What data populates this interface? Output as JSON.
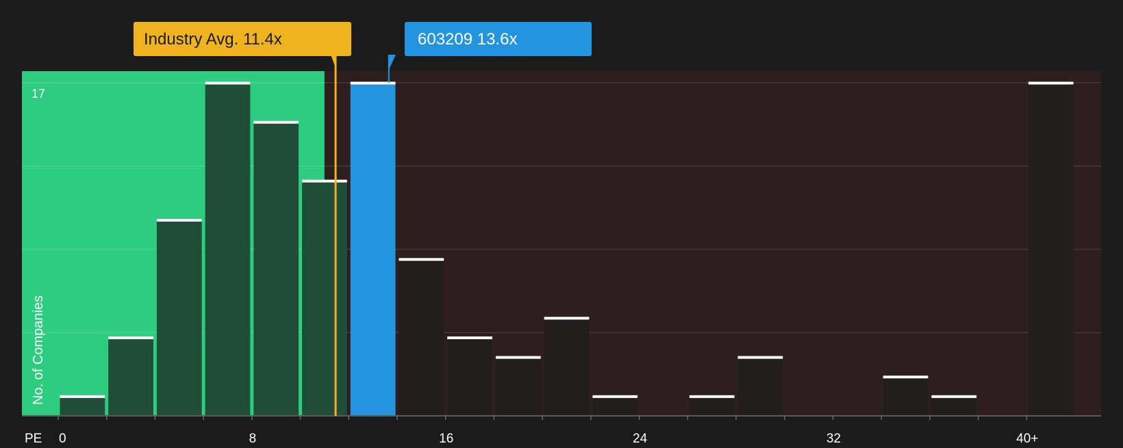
{
  "chart_data": {
    "type": "bar",
    "x_unit": "PE",
    "y_axis_label": "No. of Companies",
    "y_max_label": "17",
    "ylim": [
      0,
      17
    ],
    "x_ticks": [
      "0",
      "8",
      "16",
      "24",
      "32",
      "40+"
    ],
    "x_tick_values": [
      0,
      8,
      16,
      24,
      32,
      40
    ],
    "bin_width": 2,
    "bins": [
      {
        "start": 0,
        "value": 1
      },
      {
        "start": 2,
        "value": 4
      },
      {
        "start": 4,
        "value": 10
      },
      {
        "start": 6,
        "value": 17
      },
      {
        "start": 8,
        "value": 15
      },
      {
        "start": 10,
        "value": 12
      },
      {
        "start": 12,
        "value": 17,
        "highlight": true
      },
      {
        "start": 14,
        "value": 8
      },
      {
        "start": 16,
        "value": 4
      },
      {
        "start": 18,
        "value": 3
      },
      {
        "start": 20,
        "value": 5
      },
      {
        "start": 22,
        "value": 1
      },
      {
        "start": 24,
        "value": 0
      },
      {
        "start": 26,
        "value": 1
      },
      {
        "start": 28,
        "value": 3
      },
      {
        "start": 30,
        "value": 0
      },
      {
        "start": 32,
        "value": 0
      },
      {
        "start": 34,
        "value": 2
      },
      {
        "start": 36,
        "value": 1
      },
      {
        "start": 38,
        "value": 0
      },
      {
        "start": 40,
        "value": 17
      }
    ],
    "industry_avg": {
      "label": "Industry Avg. 11.4x",
      "value": 11.4
    },
    "company": {
      "label": "603209 13.6x",
      "value": 13.6
    },
    "green_zone_end": 11,
    "colors": {
      "background": "#1b1b1b",
      "green_zone": "#2ecc7e",
      "red_zone": "#2f1e1f",
      "bar_in_green": "#1f4d37",
      "bar_default": "#221e1e",
      "bar_highlight": "#2394e0",
      "industry_label": "#f0b31f",
      "company_label": "#2394e0",
      "cap_line": "#ffffff"
    }
  }
}
